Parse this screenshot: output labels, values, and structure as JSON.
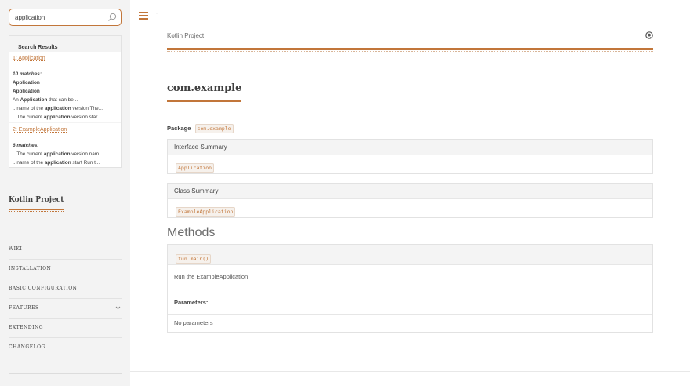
{
  "search": {
    "value": "application"
  },
  "results": {
    "header": "Search Results",
    "items": [
      {
        "title": "1: Application",
        "count": "10 matches:",
        "lines": [
          {
            "type": "bold",
            "text": "Application"
          },
          {
            "type": "bold",
            "text": "Application"
          },
          {
            "type": "snippet",
            "pre": "An ",
            "hl": "Application",
            "post": " that can be..."
          },
          {
            "type": "snippet",
            "pre": "...name of the ",
            "hl": "application",
            "post": " version The..."
          },
          {
            "type": "snippet",
            "pre": "...The current ",
            "hl": "application",
            "post": " version star..."
          }
        ]
      },
      {
        "title": "2: ExampleApplication",
        "count": "6 matches:",
        "lines": [
          {
            "type": "snippet",
            "pre": "...The current ",
            "hl": "application",
            "post": " version nam..."
          },
          {
            "type": "snippet",
            "pre": "...name of the ",
            "hl": "application",
            "post": " start Run t..."
          }
        ]
      }
    ]
  },
  "sidebar": {
    "project_title": "Kotlin Project",
    "nav": [
      {
        "label": "WIKI"
      },
      {
        "label": "INSTALLATION"
      },
      {
        "label": "BASIC CONFIGURATION"
      },
      {
        "label": "FEATURES",
        "icon": "chevron-down-icon"
      },
      {
        "label": "EXTENDING"
      },
      {
        "label": "CHANGELOG"
      }
    ]
  },
  "header": {
    "title": "Kotlin Project",
    "icons": [
      "menu-icon",
      "github-icon"
    ]
  },
  "main": {
    "heading": "com.example",
    "package_label": "Package",
    "package_name": "com.example",
    "interface_summary": {
      "title": "Interface Summary",
      "items": [
        "Application"
      ]
    },
    "class_summary": {
      "title": "Class Summary",
      "items": [
        "ExampleApplication"
      ]
    },
    "methods_heading": "Methods",
    "method": {
      "signature": "fun main()",
      "description": "Run the ExampleApplication",
      "params_label": "Parameters:",
      "params_value": "No parameters"
    }
  },
  "colors": {
    "accent": "#c2763a",
    "sidebar_bg": "#f3f3f3",
    "text": "#404040"
  }
}
